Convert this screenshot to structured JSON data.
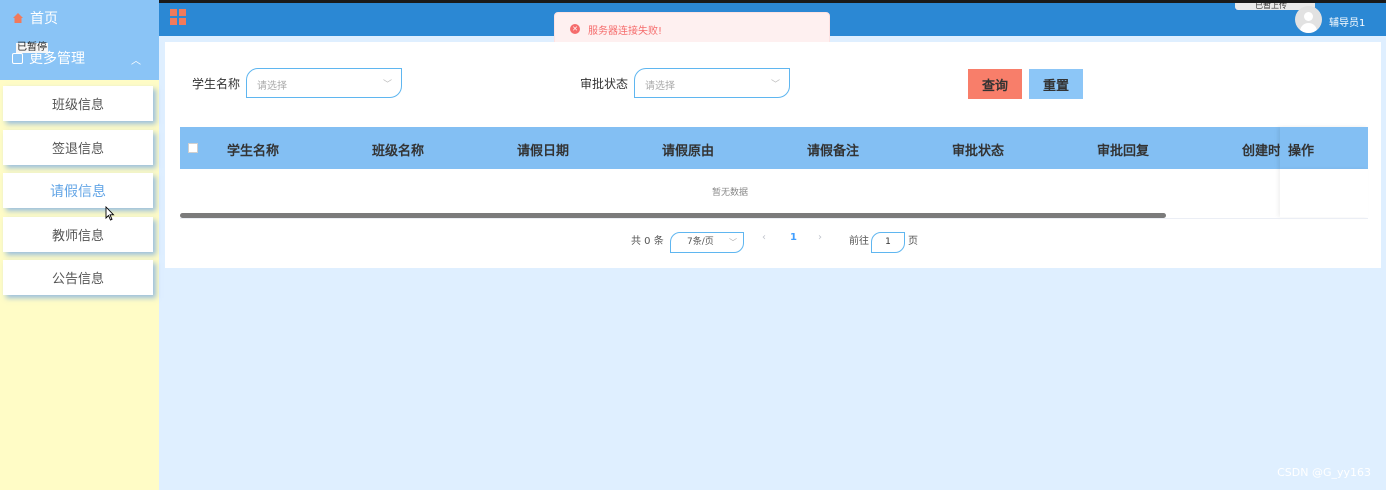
{
  "sidebar": {
    "home_label": "首页",
    "more_label": "更多管理",
    "ime_text": "已暂停",
    "submenu": [
      {
        "label": "班级信息",
        "name": "class"
      },
      {
        "label": "签退信息",
        "name": "signout"
      },
      {
        "label": "请假信息",
        "name": "leave"
      },
      {
        "label": "教师信息",
        "name": "teacher"
      },
      {
        "label": "公告信息",
        "name": "notice"
      }
    ],
    "active_index": 2
  },
  "topbar": {
    "upload_label": "已暂上传",
    "username": "辅导员1"
  },
  "toast": {
    "message": "服务器连接失败!"
  },
  "filters": {
    "student_label": "学生名称",
    "student_placeholder": "请选择",
    "status_label": "审批状态",
    "status_placeholder": "请选择",
    "search_button": "查询",
    "reset_button": "重置"
  },
  "table": {
    "columns": [
      "学生名称",
      "班级名称",
      "请假日期",
      "请假原由",
      "请假备注",
      "审批状态",
      "审批回复",
      "创建时间"
    ],
    "action_column": "操作",
    "empty_text": "暂无数据"
  },
  "pagination": {
    "total_text": "共 0 条",
    "page_size": "7条/页",
    "current_page": "1",
    "goto_label": "前往",
    "goto_value": "1",
    "page_suffix": "页"
  },
  "watermark": "CSDN @G_yy163",
  "colors": {
    "sidebar_bg": "#fffcc6",
    "nav_header": "#8ac4f6",
    "topbar": "#2b88d4",
    "table_header": "#83bff3",
    "search_button": "#f87e6a",
    "reset_button": "#8cc6f7",
    "error": "#f56c6c"
  }
}
